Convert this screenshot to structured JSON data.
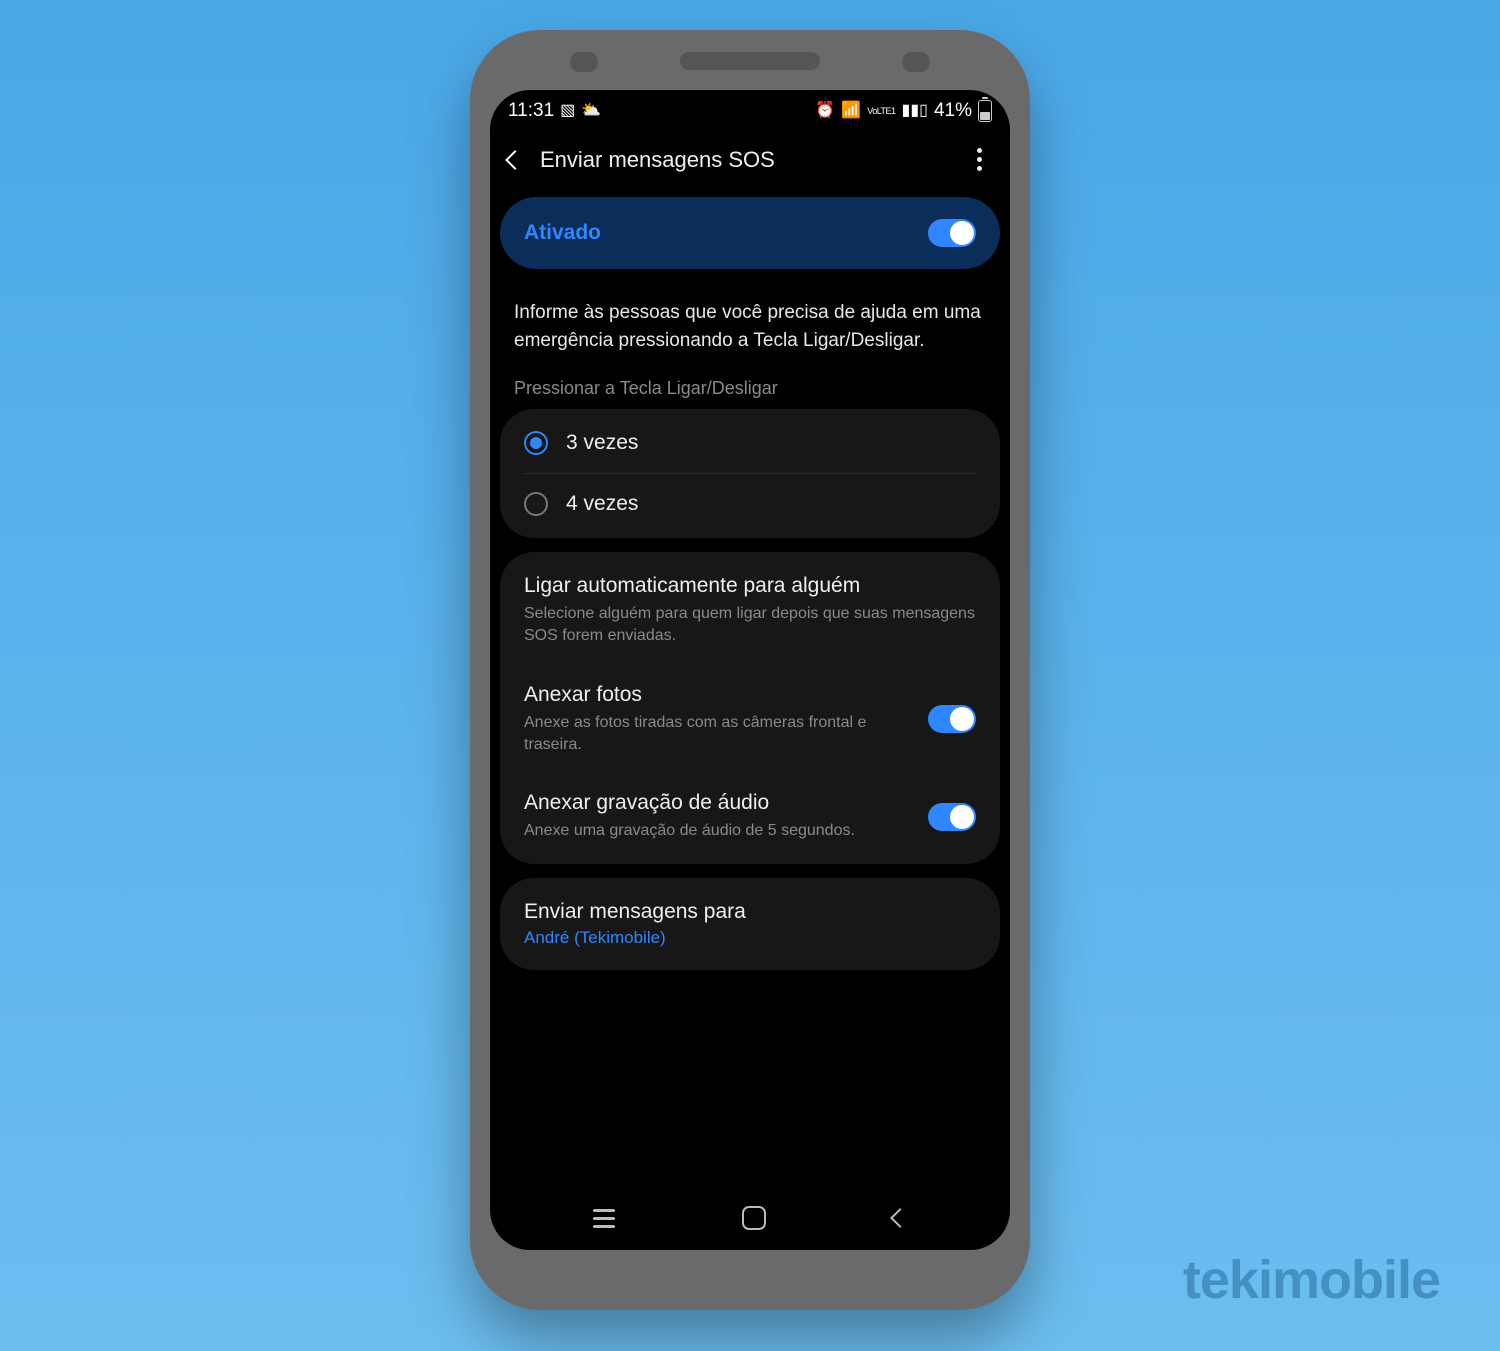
{
  "watermark": "tekimobile",
  "status": {
    "time": "11:31",
    "battery_pct": "41%",
    "lte": "VoLTE1"
  },
  "header": {
    "title": "Enviar mensagens SOS"
  },
  "master_toggle": {
    "label": "Ativado",
    "on": true
  },
  "description": "Informe às pessoas que você precisa de ajuda em uma emergência pressionando a Tecla Ligar/Desligar.",
  "press_section_label": "Pressionar a Tecla Ligar/Desligar",
  "press_options": [
    {
      "label": "3 vezes",
      "selected": true
    },
    {
      "label": "4 vezes",
      "selected": false
    }
  ],
  "settings": {
    "auto_call": {
      "title": "Ligar automaticamente para alguém",
      "sub": "Selecione alguém para quem ligar depois que suas mensagens SOS forem enviadas."
    },
    "attach_photos": {
      "title": "Anexar fotos",
      "sub": "Anexe as fotos tiradas com as câmeras frontal e traseira.",
      "on": true
    },
    "attach_audio": {
      "title": "Anexar gravação de áudio",
      "sub": "Anexe uma gravação de áudio de 5 segundos.",
      "on": true
    }
  },
  "recipients": {
    "title": "Enviar mensagens para",
    "value": "André (Tekimobile)"
  }
}
